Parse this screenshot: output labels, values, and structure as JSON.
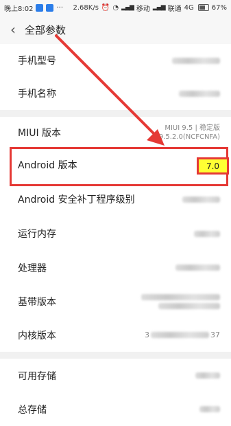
{
  "status_bar": {
    "time": "晚上8:02",
    "network_speed": "2.68K/s",
    "carrier1": "移动",
    "carrier2": "联通",
    "network_type": "4G",
    "battery": "67%"
  },
  "header": {
    "back_icon": "chevron-left-icon",
    "title": "全部参数"
  },
  "rows": {
    "model": {
      "label": "手机型号"
    },
    "name": {
      "label": "手机名称"
    },
    "miui": {
      "label": "MIUI 版本",
      "value_line1": "MIUI 9.5 | 稳定版",
      "value_line2": "9.5.2.0(NCFCNFA)"
    },
    "android": {
      "label": "Android 版本",
      "value": "7.0"
    },
    "security_patch": {
      "label": "Android 安全补丁程序级别"
    },
    "ram": {
      "label": "运行内存"
    },
    "processor": {
      "label": "处理器"
    },
    "baseband": {
      "label": "基带版本"
    },
    "kernel": {
      "label": "内核版本",
      "value_prefix": "3",
      "value_suffix": "37"
    },
    "available_storage": {
      "label": "可用存储"
    },
    "total_storage": {
      "label": "总存储"
    }
  },
  "annotation": {
    "color": "#e53935",
    "highlight_color": "#ffff33"
  }
}
